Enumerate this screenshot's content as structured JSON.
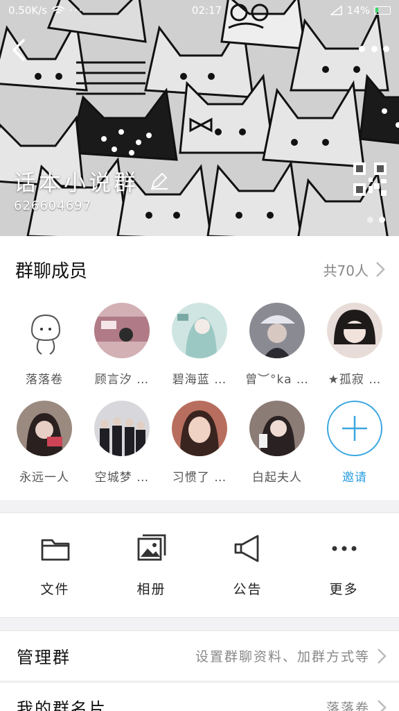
{
  "status_bar": {
    "speed": "0.50K/s",
    "time": "02:17",
    "battery": "14%"
  },
  "header": {
    "group_name": "话本小说群",
    "group_id": "626604697",
    "icons": [
      "back-arrow-icon",
      "more-dots-icon",
      "edit-pencil-icon",
      "qr-code-icon"
    ]
  },
  "members": {
    "title": "群聊成员",
    "count_label": "共70人",
    "list": [
      {
        "name": "落落卷",
        "tone": "#f4f4f4"
      },
      {
        "name": "顾言汐 …",
        "tone": "#b07b86"
      },
      {
        "name": "碧海蓝 …",
        "tone": "#9cc8c4"
      },
      {
        "name": "曾︶°ka …",
        "tone": "#6a6a70"
      },
      {
        "name": "★孤寂 …",
        "tone": "#d8c8c2"
      },
      {
        "name": "永远一人",
        "tone": "#5a4a44"
      },
      {
        "name": "空城梦 …",
        "tone": "#3c3c44"
      },
      {
        "name": "习惯了 …",
        "tone": "#c98a78"
      },
      {
        "name": "白起夫人",
        "tone": "#7a6a66"
      }
    ],
    "invite_label": "邀请"
  },
  "actions": [
    {
      "label": "文件",
      "icon": "folder-icon"
    },
    {
      "label": "相册",
      "icon": "album-icon"
    },
    {
      "label": "公告",
      "icon": "announcement-icon"
    },
    {
      "label": "更多",
      "icon": "more-icon"
    }
  ],
  "manage": {
    "title": "管理群",
    "value": "设置群聊资料、加群方式等"
  },
  "my_card": {
    "title": "我的群名片",
    "value": "落落卷"
  },
  "colors": {
    "accent": "#3aa6e0",
    "card_bg": "#ffffff",
    "page_bg": "#f2f2f4"
  }
}
